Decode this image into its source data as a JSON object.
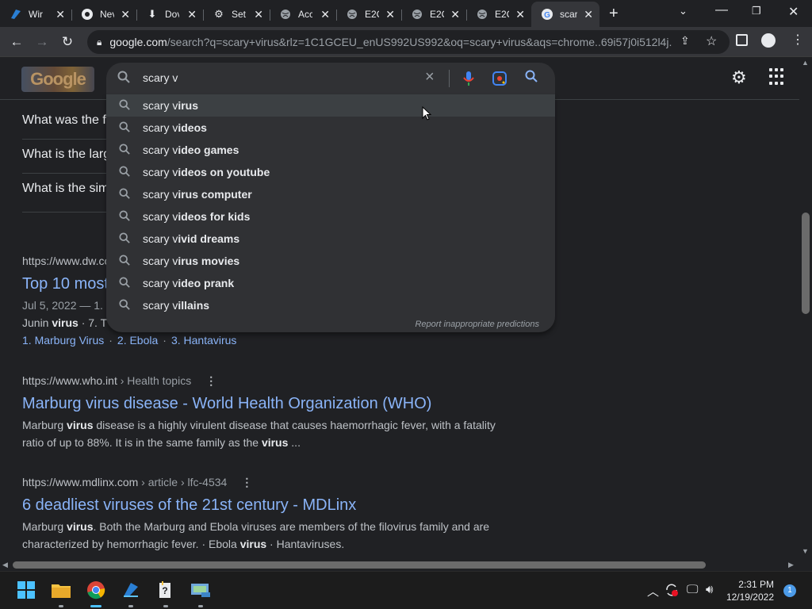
{
  "browser": {
    "tabs": [
      {
        "title": "Wir",
        "icon": "edge-like-icon",
        "active": false
      },
      {
        "title": "Nev",
        "icon": "chrome-icon",
        "active": false
      },
      {
        "title": "Dov",
        "icon": "download-icon",
        "active": false
      },
      {
        "title": "Sett",
        "icon": "gear-icon",
        "active": false
      },
      {
        "title": "Acc",
        "icon": "globe-icon",
        "active": false
      },
      {
        "title": "E2C",
        "icon": "globe-icon",
        "active": false
      },
      {
        "title": "E2C",
        "icon": "globe-icon",
        "active": false
      },
      {
        "title": "E2C",
        "icon": "globe-icon",
        "active": false
      },
      {
        "title": "scar",
        "icon": "google-icon",
        "active": true
      }
    ],
    "url_domain": "google.com",
    "url_rest": "/search?q=scary+virus&rlz=1C1GCEU_enUS992US992&oq=scary+virus&aqs=chrome..69i57j0i512l4j..."
  },
  "search": {
    "query": "scary v",
    "suggestions": [
      {
        "pre": "scary v",
        "post": "irus"
      },
      {
        "pre": "scary v",
        "post": "ideos"
      },
      {
        "pre": "scary v",
        "post": "ideo games"
      },
      {
        "pre": "scary v",
        "post": "ideos on youtube"
      },
      {
        "pre": "scary v",
        "post": "irus computer"
      },
      {
        "pre": "scary v",
        "post": "ideos for kids"
      },
      {
        "pre": "scary v",
        "post": "ivid dreams"
      },
      {
        "pre": "scary v",
        "post": "irus movies"
      },
      {
        "pre": "scary v",
        "post": "ideo prank"
      },
      {
        "pre": "scary v",
        "post": "illains"
      }
    ],
    "report_label": "Report inappropriate predictions"
  },
  "people_also_ask": [
    "What was the f",
    "What is the larg",
    "What is the sim"
  ],
  "results": [
    {
      "cite": "https://www.dw.co",
      "title": "Top 10 most",
      "snippet_1": "Jul 5, 2022 — 1.",
      "snippet_2_pre": "Junin ",
      "snippet_2_bold": "virus",
      "snippet_2_post": " · 7. T",
      "sitelinks": [
        "1. Marburg Virus",
        "2. Ebola",
        "3. Hantavirus"
      ]
    },
    {
      "cite_domain": "https://www.who.int",
      "cite_path": " › Health topics",
      "title": "Marburg virus disease - World Health Organization (WHO)",
      "s1": "Marburg ",
      "s2": "virus",
      "s3": " disease is a highly virulent disease that causes haemorrhagic fever, with a fatality ratio of up to 88%. It is in the same family as the ",
      "s4": "virus",
      "s5": " ..."
    },
    {
      "cite_domain": "https://www.mdlinx.com",
      "cite_path": " › article › lfc-4534",
      "title": "6 deadliest viruses of the 21st century - MDLinx",
      "s1": "Marburg ",
      "s2": "virus",
      "s3": ". Both the Marburg and Ebola viruses are members of the filovirus family and are characterized by hemorrhagic fever. · Ebola ",
      "s4": "virus",
      "s5": " · Hantaviruses."
    }
  ],
  "taskbar": {
    "time": "2:31 PM",
    "date": "12/19/2022",
    "notifications": "1"
  },
  "colors": {
    "link": "#8ab4f8",
    "background": "#202124",
    "searchbox": "#303134"
  }
}
